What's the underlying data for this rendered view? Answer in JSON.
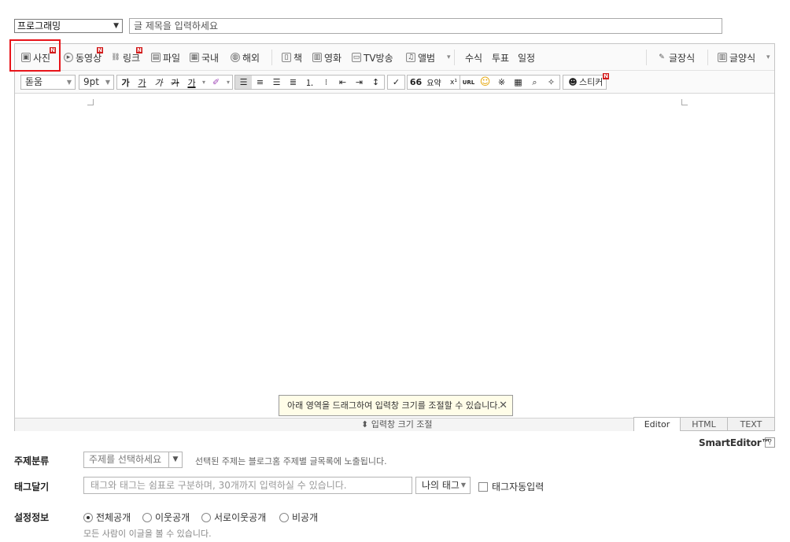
{
  "header": {
    "category_value": "프로그래밍",
    "title_placeholder": "글 제목을 입력하세요"
  },
  "toolbar1": {
    "items": [
      {
        "label": "사진",
        "icon": "camera-icon",
        "new": true
      },
      {
        "label": "동영상",
        "icon": "play-icon",
        "new": true
      },
      {
        "label": "링크",
        "icon": "link-icon",
        "new": true
      },
      {
        "label": "파일",
        "icon": "file-icon"
      },
      {
        "label": "국내",
        "icon": "map-icon"
      },
      {
        "label": "해외",
        "icon": "globe-icon"
      },
      {
        "label": "책",
        "icon": "book-icon"
      },
      {
        "label": "영화",
        "icon": "film-icon"
      },
      {
        "label": "TV방송",
        "icon": "tv-icon"
      },
      {
        "label": "앨범",
        "icon": "music-icon"
      },
      {
        "label": "수식"
      },
      {
        "label": "투표"
      },
      {
        "label": "일정"
      },
      {
        "label": "글장식",
        "icon": "brush-icon"
      },
      {
        "label": "글양식",
        "icon": "template-icon"
      }
    ],
    "new_badge": "N"
  },
  "toolbar2": {
    "font": "돋움",
    "size": "9pt",
    "text_buttons": [
      "가",
      "가",
      "가",
      "가",
      "가"
    ],
    "quote": "66",
    "summary": "요약",
    "url": "URL",
    "sticker": "스티커",
    "new_badge": "N"
  },
  "editor": {
    "tooltip": "아래 영역을 드래그하여 입력창 크기를 조절할 수 있습니다.",
    "tooltip_close": "✕",
    "resize_label": "입력창 크기 조절",
    "resize_icon": "⬍",
    "modes": [
      "Editor",
      "HTML",
      "TEXT"
    ],
    "brand": "SmartEditor™",
    "help": "?"
  },
  "form": {
    "topic_label": "주제분류",
    "topic_placeholder": "주제를 선택하세요",
    "topic_hint": "선택된 주제는 블로그홈 주제별 글목록에 노출됩니다.",
    "tag_label": "태그달기",
    "tag_placeholder": "태그와 태그는 쉼표로 구분하며, 30개까지 입력하실 수 있습니다.",
    "my_tag": "나의 태그",
    "auto_tag": "태그자동입력",
    "settings_label": "설정정보",
    "visibility": [
      {
        "label": "전체공개",
        "selected": true
      },
      {
        "label": "이웃공개",
        "selected": false
      },
      {
        "label": "서로이웃공개",
        "selected": false
      },
      {
        "label": "비공개",
        "selected": false
      }
    ],
    "visibility_hint": "모든 사람이 이글을 볼 수 있습니다."
  }
}
